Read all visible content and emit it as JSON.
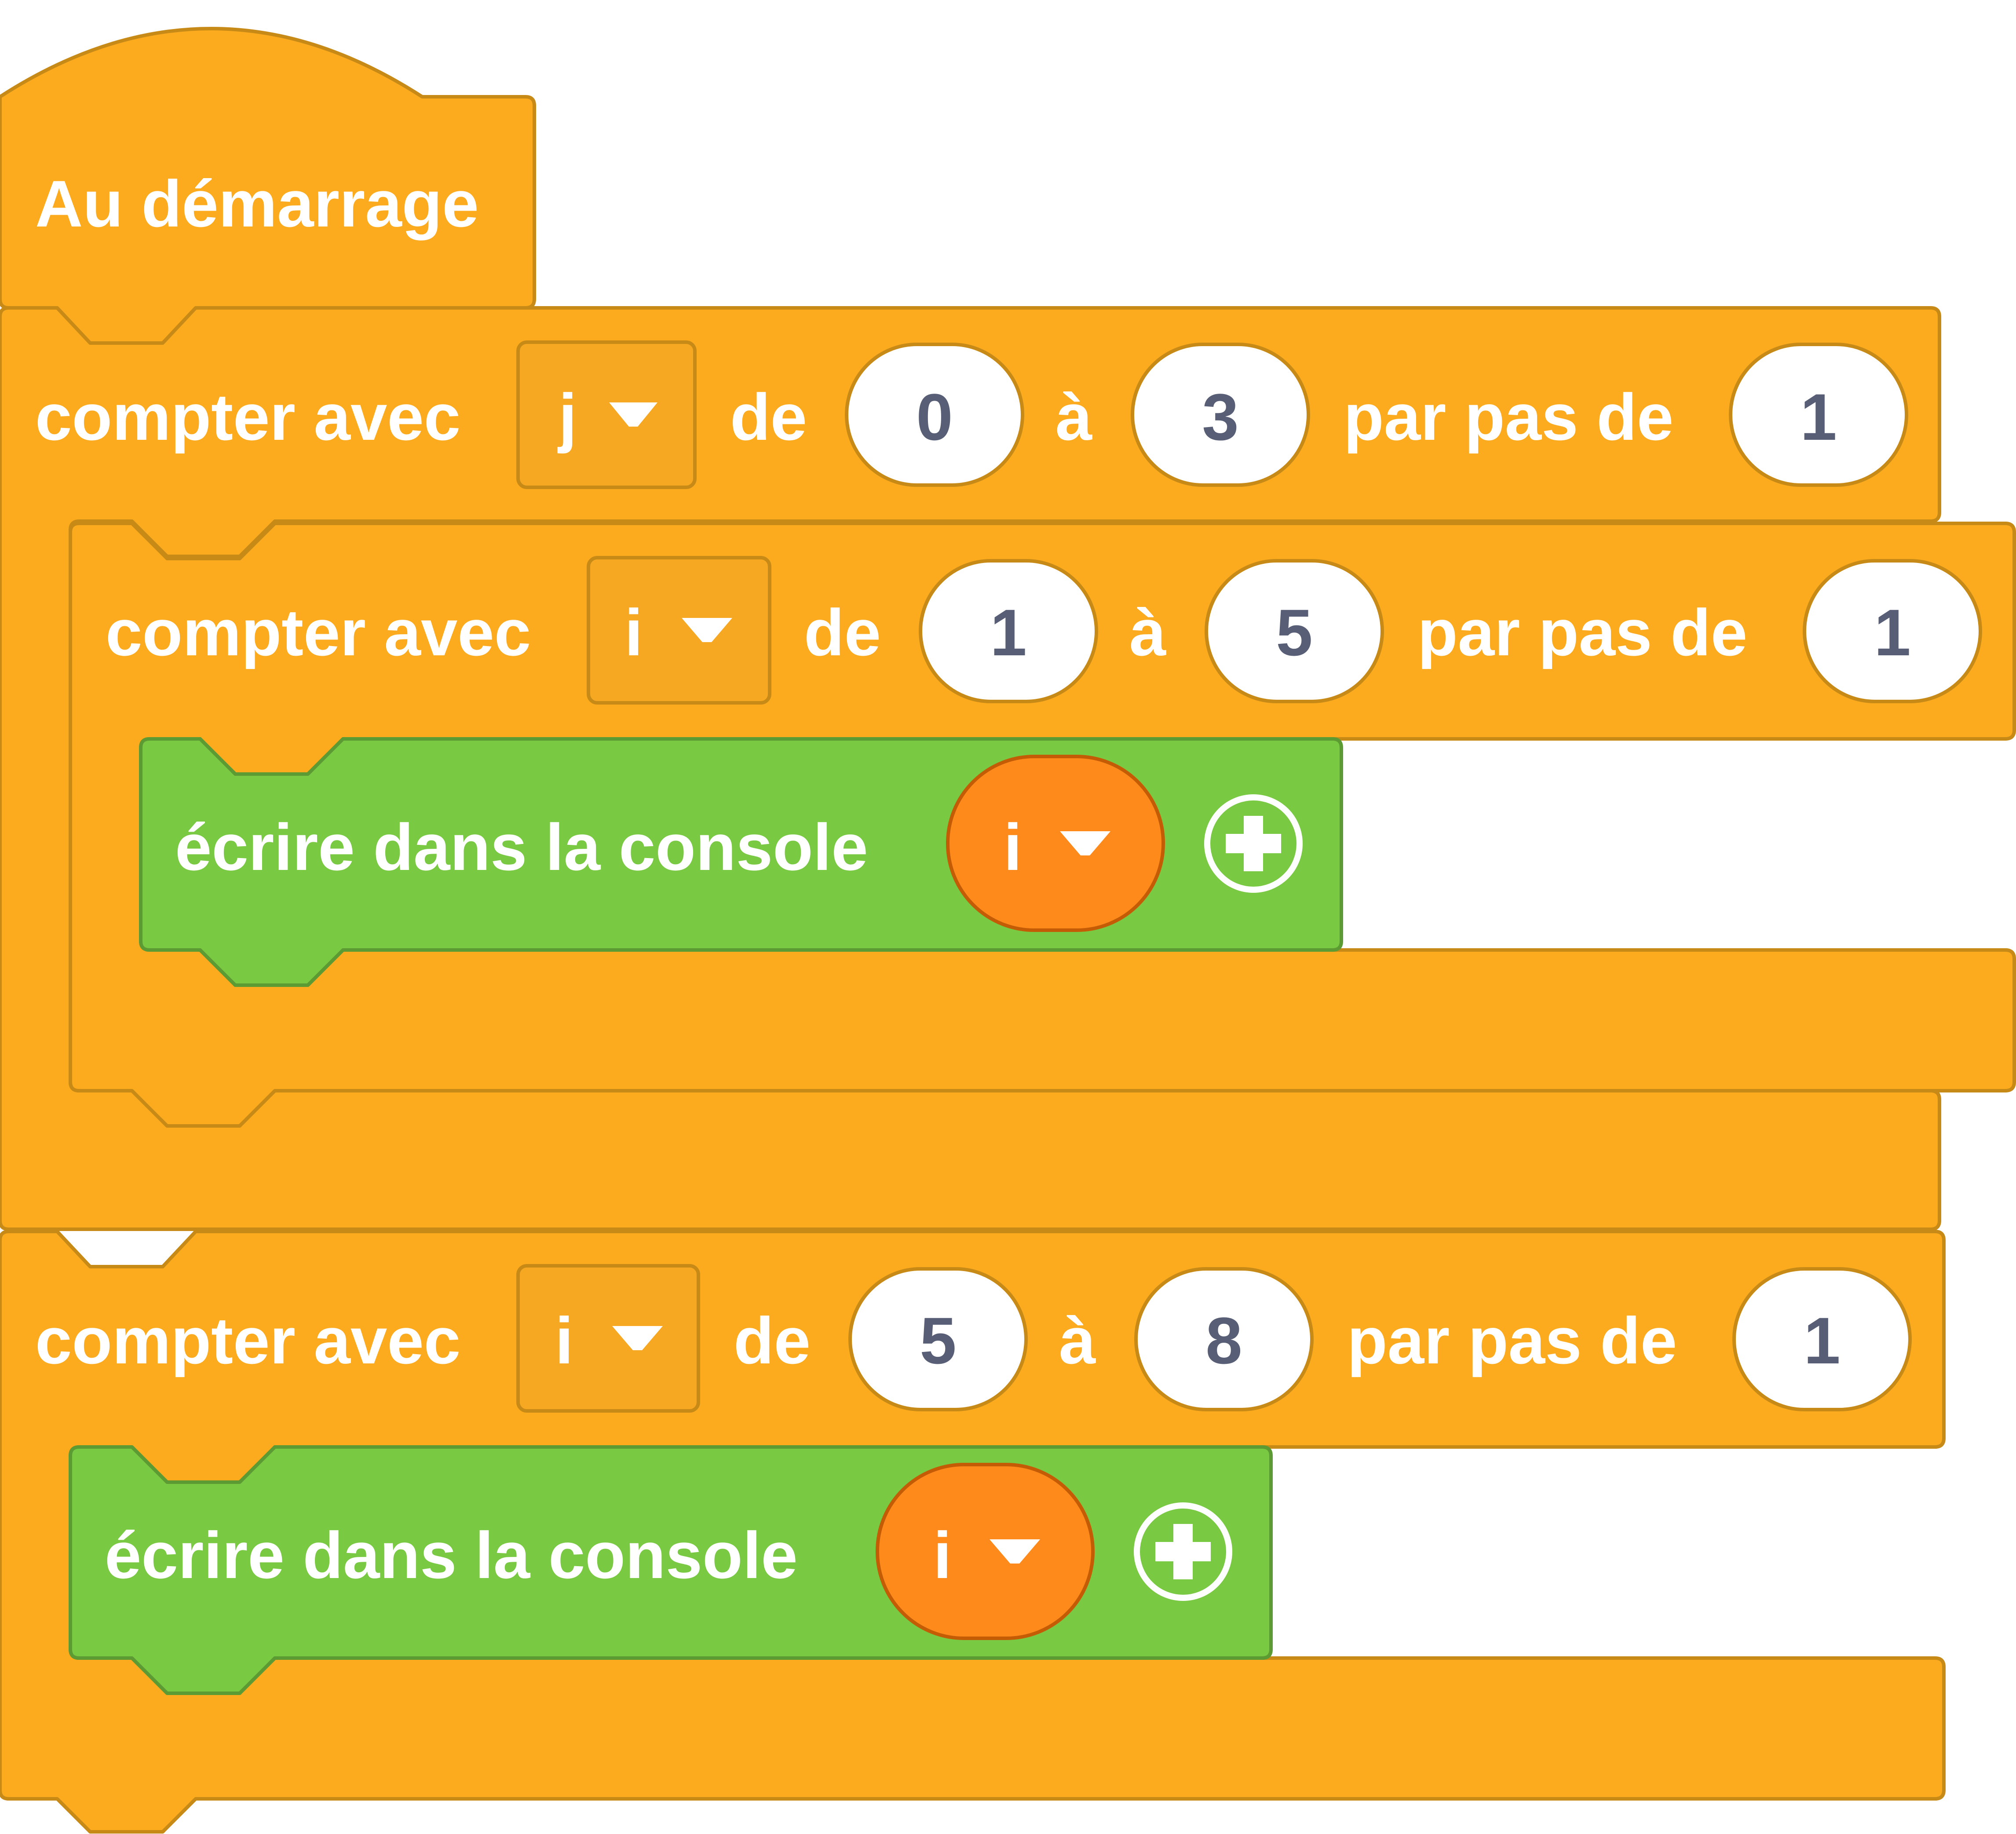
{
  "hat": {
    "label": "Au démarrage"
  },
  "loop_outer": {
    "label_count": "compter avec",
    "var": "j",
    "label_from": "de",
    "from": "0",
    "label_to": "à",
    "to": "3",
    "label_step": "par pas de",
    "step": "1"
  },
  "loop_inner": {
    "label_count": "compter avec",
    "var": "i",
    "label_from": "de",
    "from": "1",
    "label_to": "à",
    "to": "5",
    "label_step": "par pas de",
    "step": "1"
  },
  "print_inner": {
    "label": "écrire dans la console",
    "var": "i"
  },
  "loop_second": {
    "label_count": "compter avec",
    "var": "i",
    "label_from": "de",
    "from": "5",
    "label_to": "à",
    "to": "8",
    "label_step": "par pas de",
    "step": "1"
  },
  "print_second": {
    "label": "écrire dans la console",
    "var": "i"
  },
  "colors": {
    "loops": "#fcab1e",
    "console": "#7ac943",
    "variable_reporter": "#ff8a1c",
    "number_text": "#575e75"
  }
}
